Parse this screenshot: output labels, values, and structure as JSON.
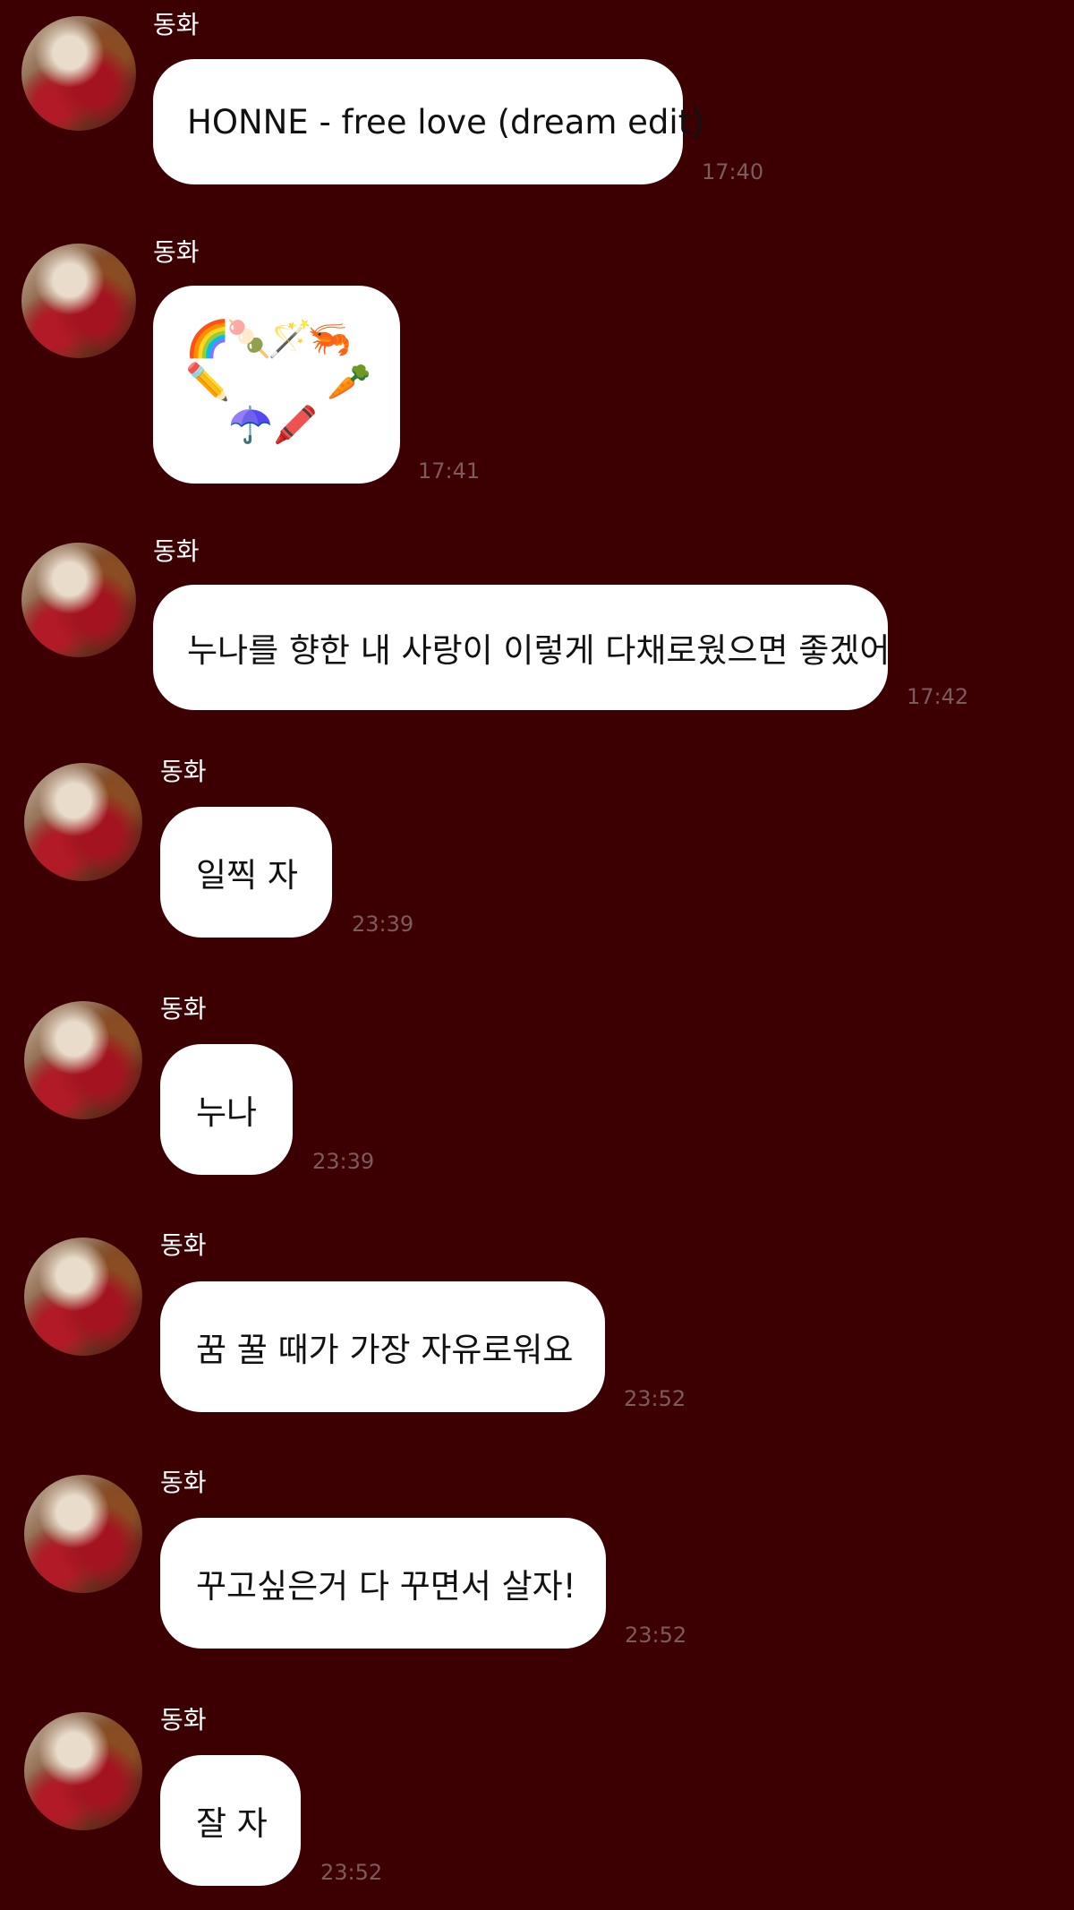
{
  "messages": [
    {
      "sender": "동화",
      "text": "HONNE - free love (dream edit)",
      "time": "17:40"
    },
    {
      "sender": "동화",
      "type": "emoji-heart",
      "emojis": [
        "🌈",
        "🍡",
        "🪄",
        "🦐",
        "✏️",
        "🥕",
        "☂️",
        "🖍️"
      ],
      "time": "17:41"
    },
    {
      "sender": "동화",
      "text": "누나를 향한 내 사랑이 이렇게 다채로웠으면 좋겠어",
      "time": "17:42"
    },
    {
      "sender": "동화",
      "text": "일찍 자",
      "time": "23:39"
    },
    {
      "sender": "동화",
      "text": "누나",
      "time": "23:39"
    },
    {
      "sender": "동화",
      "text": "꿈 꿀 때가 가장 자유로워요",
      "time": "23:52"
    },
    {
      "sender": "동화",
      "text": "꾸고싶은거 다 꾸면서 살자!",
      "time": "23:52"
    },
    {
      "sender": "동화",
      "text": "잘 자",
      "time": "23:52"
    }
  ]
}
